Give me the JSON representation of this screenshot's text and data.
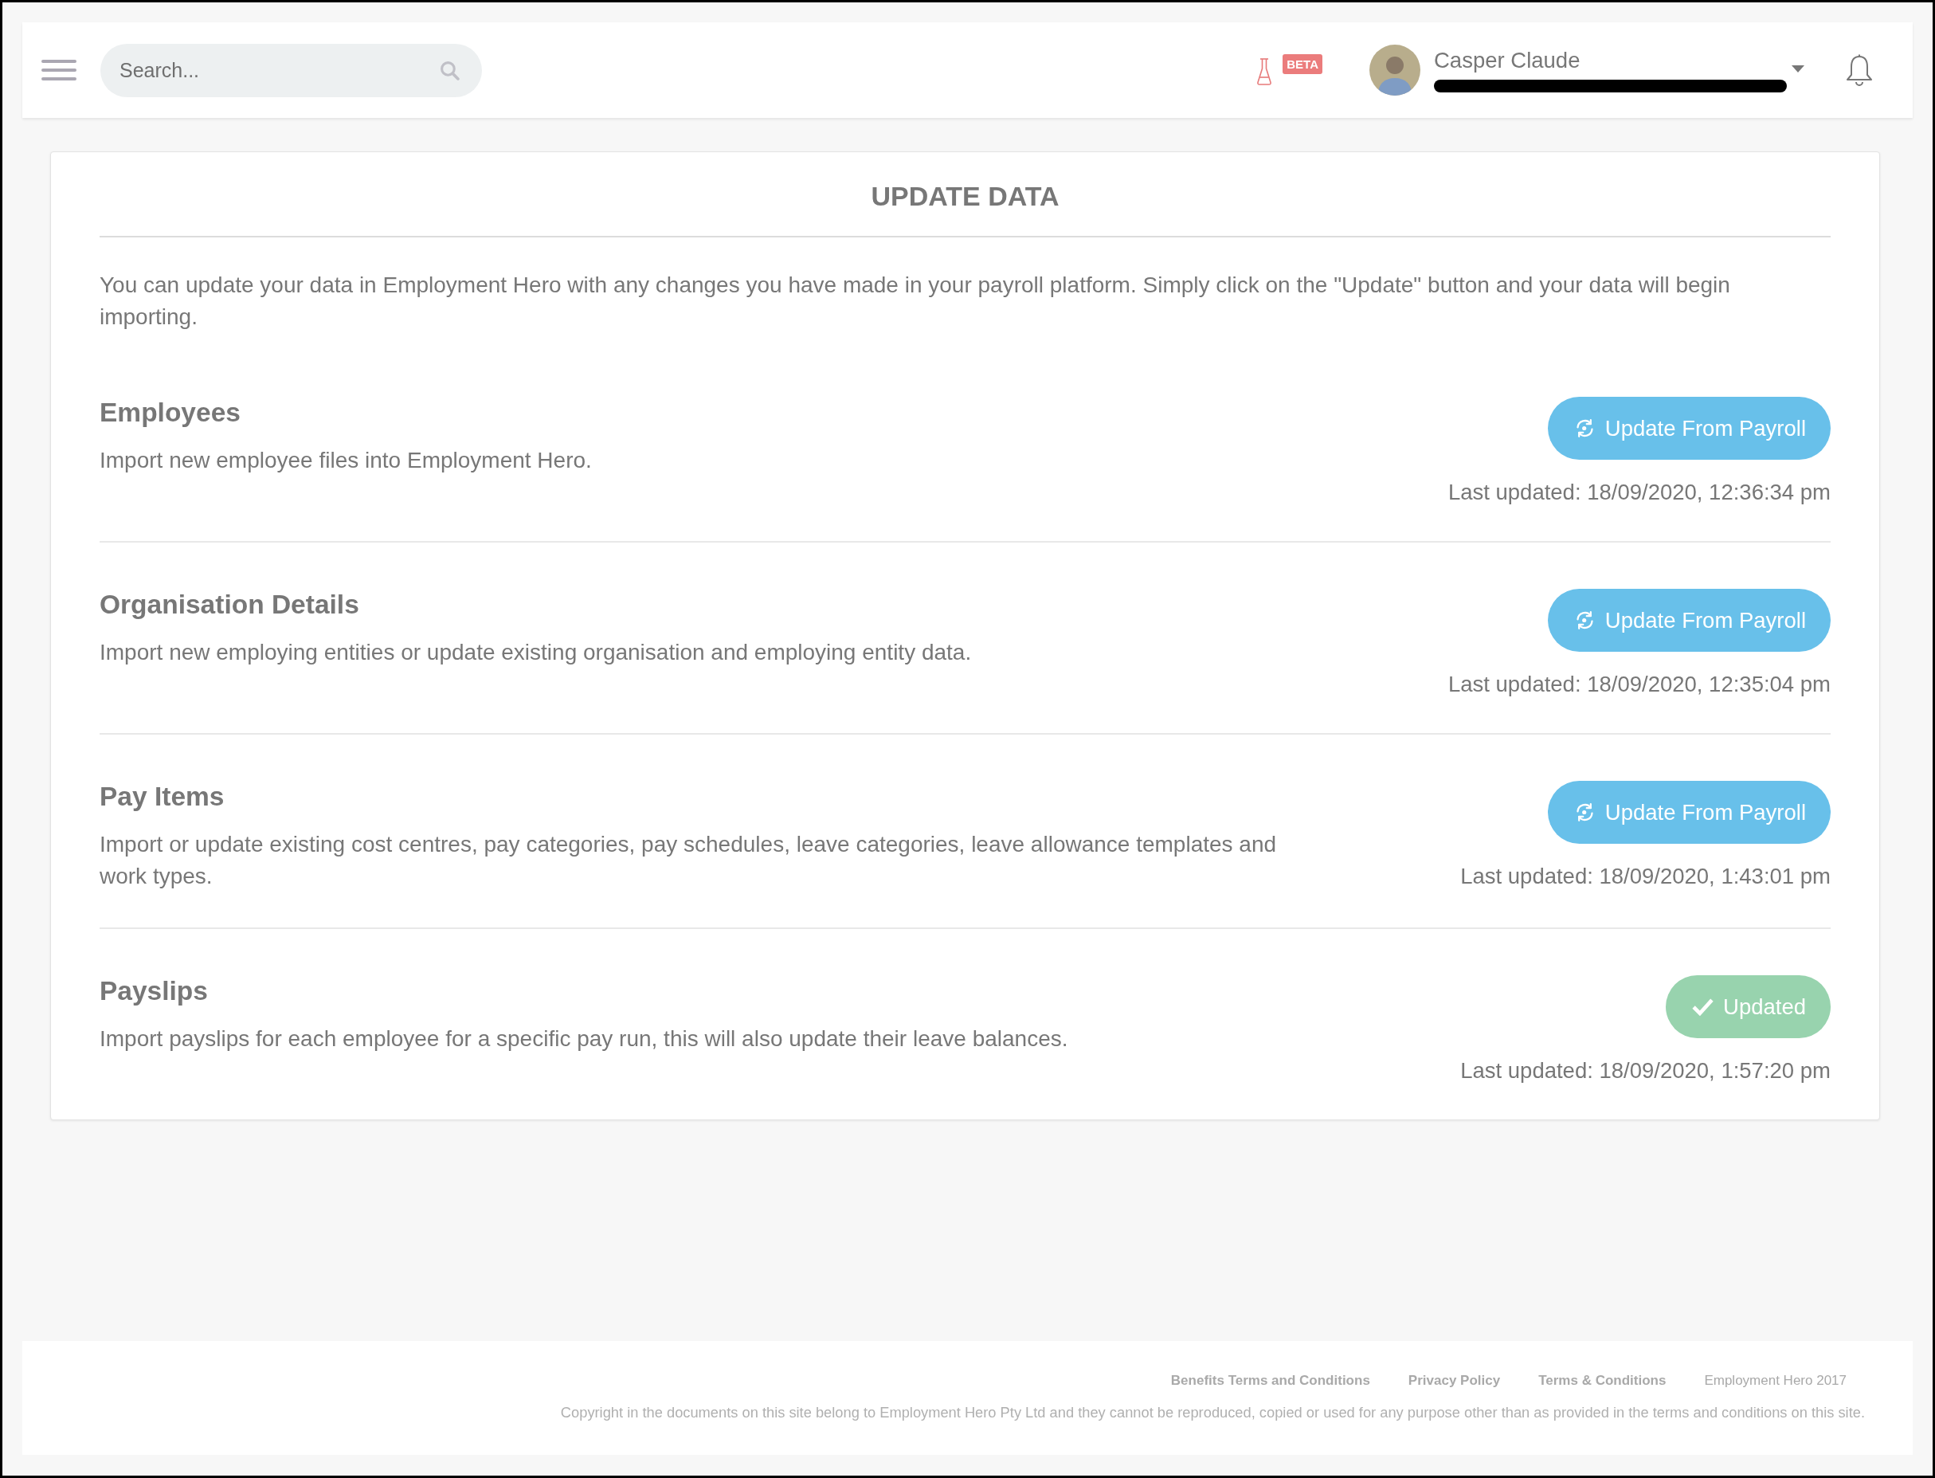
{
  "header": {
    "search": {
      "placeholder": "Search..."
    },
    "beta_badge": "BETA",
    "user": {
      "name": "Casper Claude"
    }
  },
  "card": {
    "title": "UPDATE DATA",
    "intro": "You can update your data in Employment Hero with any changes you have made in your payroll platform. Simply click on the \"Update\" button and your data will begin importing.",
    "sections": [
      {
        "title": "Employees",
        "description": "Import new employee files into Employment Hero.",
        "button": {
          "kind": "update",
          "label": "Update From Payroll"
        },
        "last_updated": "Last updated: 18/09/2020, 12:36:34 pm"
      },
      {
        "title": "Organisation Details",
        "description": "Import new employing entities or update existing organisation and employing entity data.",
        "button": {
          "kind": "update",
          "label": "Update From Payroll"
        },
        "last_updated": "Last updated: 18/09/2020, 12:35:04 pm"
      },
      {
        "title": "Pay Items",
        "description": "Import or update existing cost centres, pay categories, pay schedules, leave categories, leave allowance templates and work types.",
        "button": {
          "kind": "update",
          "label": "Update From Payroll"
        },
        "last_updated": "Last updated: 18/09/2020, 1:43:01 pm"
      },
      {
        "title": "Payslips",
        "description": "Import payslips for each employee for a specific pay run, this will also update their leave balances.",
        "button": {
          "kind": "updated",
          "label": "Updated"
        },
        "last_updated": "Last updated: 18/09/2020, 1:57:20 pm"
      }
    ]
  },
  "footer": {
    "items": [
      {
        "kind": "link",
        "label": "Benefits Terms and Conditions"
      },
      {
        "kind": "link",
        "label": "Privacy Policy"
      },
      {
        "kind": "link",
        "label": "Terms & Conditions"
      },
      {
        "kind": "text",
        "label": "Employment Hero 2017"
      }
    ],
    "copyright": "Copyright in the documents on this site belong to Employment Hero Pty Ltd and they cannot be reproduced, copied or used for any purpose other than as provided in the terms and conditions on this site."
  }
}
